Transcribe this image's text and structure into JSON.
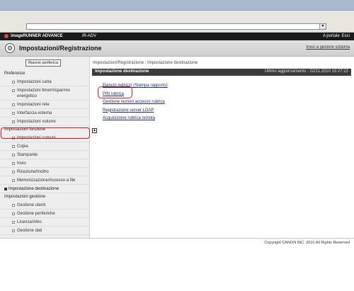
{
  "header": {
    "brand": "imageRUNNER ADVANCE",
    "model": "iR-ADV",
    "links": [
      "A portale",
      "Esci"
    ]
  },
  "title": {
    "text": "Impostazioni/Registrazione",
    "goto_system": "Invio a gestore sistema"
  },
  "sidebar": {
    "restart_button": "Riavvio periferica",
    "sections": [
      {
        "title": "Preferenze",
        "items": [
          "Impostazioni carta",
          "Impostazioni timer/risparmio energetico",
          "Impostazioni rete",
          "Interfaccia esterna",
          "Impostazioni volume"
        ]
      },
      {
        "title": "Impostazioni funzione",
        "items": [
          "Impostazioni comuni",
          "Copia",
          "Stampante",
          "Invio",
          "Ricezione/Inoltro",
          "Memorizzazione/Accesso a file",
          "Impostazione destinazione"
        ]
      },
      {
        "title": "Impostazioni gestione",
        "items": [
          "Gestione utenti",
          "Gestione periferiche",
          "Licenza/Altro",
          "Gestione dati"
        ]
      }
    ]
  },
  "main": {
    "breadcrumb": "Impostazioni/Registrazione : Impostazione destinazione",
    "section_title": "Impostazione destinazione",
    "last_update": "Ultimo aggiornamento : 22/11.2010 15:27:22",
    "links": [
      "Elenchi indirizzi (Stampa rapporto)",
      "PIN rubrica",
      "Gestione numeri accesso rubrica",
      "Registrazione server LDAP",
      "Acquisizione rubrica remota"
    ],
    "top_button": "▲"
  },
  "footer": {
    "copyright": "Copyright CANON INC. 2010 All Rights Reserved"
  },
  "colors": {
    "highlight": "#d11b1b",
    "banner": "#1b1b1b",
    "section_bar": "#3b3b3b"
  }
}
